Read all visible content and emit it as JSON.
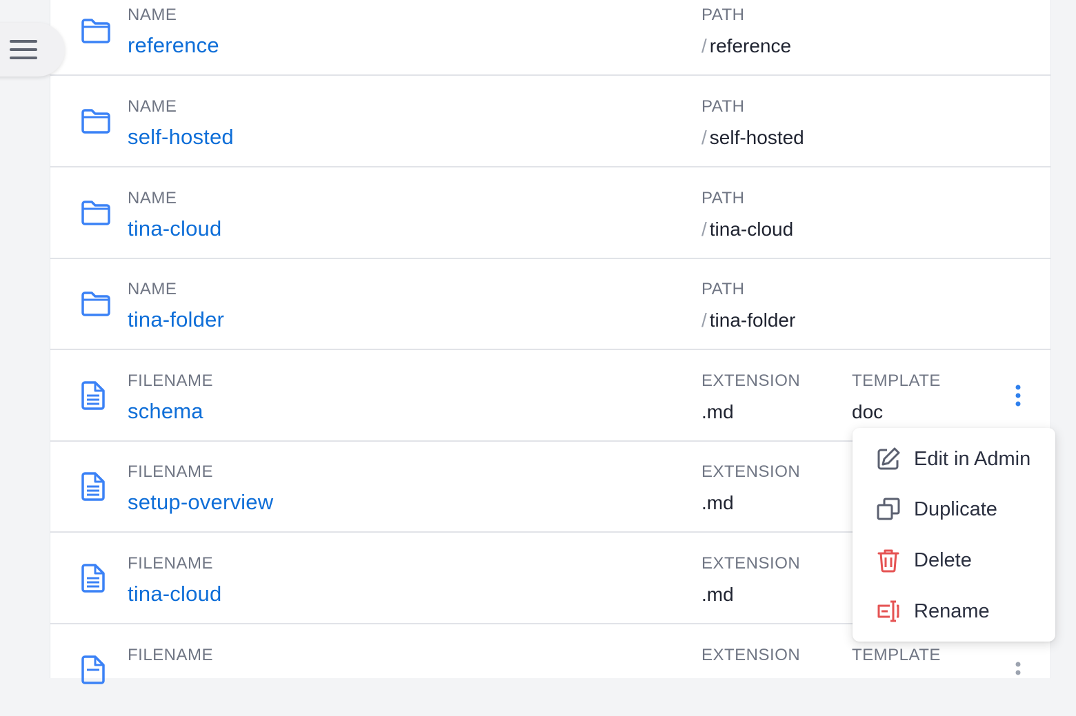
{
  "rows": [
    {
      "kind": "folder",
      "label1": "NAME",
      "name": "reference",
      "label2": "PATH",
      "path": "reference"
    },
    {
      "kind": "folder",
      "label1": "NAME",
      "name": "self-hosted",
      "label2": "PATH",
      "path": "self-hosted"
    },
    {
      "kind": "folder",
      "label1": "NAME",
      "name": "tina-cloud",
      "label2": "PATH",
      "path": "tina-cloud"
    },
    {
      "kind": "folder",
      "label1": "NAME",
      "name": "tina-folder",
      "label2": "PATH",
      "path": "tina-folder"
    },
    {
      "kind": "file",
      "label1": "FILENAME",
      "name": "schema",
      "label2": "EXTENSION",
      "extension": ".md",
      "label3": "TEMPLATE",
      "template": "doc"
    },
    {
      "kind": "file",
      "label1": "FILENAME",
      "name": "setup-overview",
      "label2": "EXTENSION",
      "extension": ".md"
    },
    {
      "kind": "file",
      "label1": "FILENAME",
      "name": "tina-cloud",
      "label2": "EXTENSION",
      "extension": ".md"
    },
    {
      "kind": "file",
      "label1": "FILENAME",
      "label2": "EXTENSION",
      "label3": "TEMPLATE"
    }
  ],
  "path_separator": "/",
  "dropdown": {
    "items": [
      {
        "label": "Edit in Admin",
        "icon": "edit-icon"
      },
      {
        "label": "Duplicate",
        "icon": "duplicate-icon"
      },
      {
        "label": "Delete",
        "icon": "trash-icon"
      },
      {
        "label": "Rename",
        "icon": "rename-icon"
      }
    ]
  },
  "colors": {
    "link": "#0e6ed8",
    "icon_blue": "#3b82f6",
    "danger": "#e55353",
    "muted": "#707684"
  }
}
